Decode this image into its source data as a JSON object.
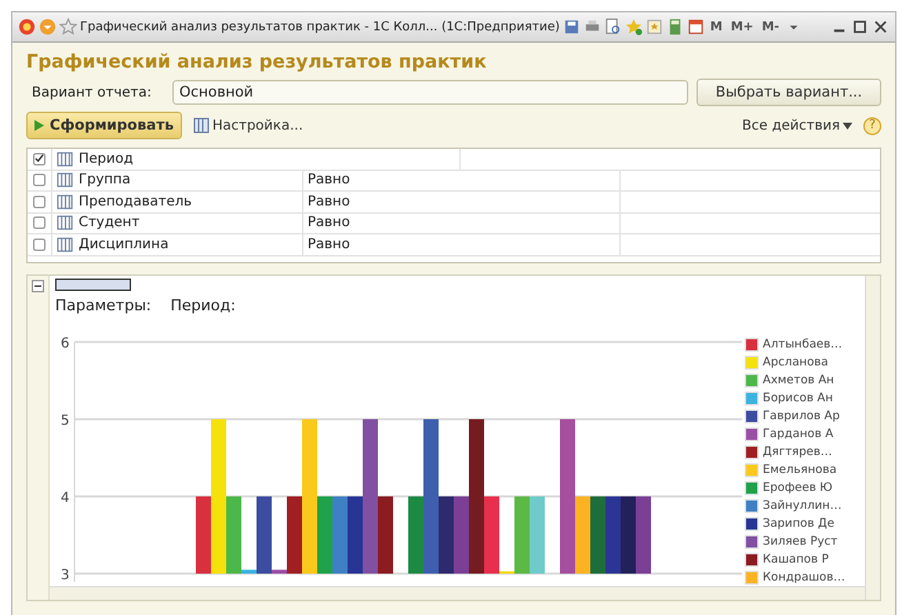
{
  "window": {
    "title": "Графический анализ результатов практик - 1С Колл...  (1С:Предприятие)",
    "memory_buttons": [
      "M",
      "M+",
      "M-"
    ]
  },
  "form": {
    "title": "Графический анализ результатов практик",
    "variant_label": "Вариант отчета:",
    "variant_value": "Основной",
    "choose_button": "Выбрать вариант...",
    "generate_button": "Сформировать",
    "settings_button": "Настройка...",
    "all_actions": "Все действия",
    "help": "?"
  },
  "filters": [
    {
      "name": "Период",
      "checked": true
    },
    {
      "name": "Группа",
      "checked": false,
      "condition": "Равно"
    },
    {
      "name": "Преподаватель",
      "checked": false,
      "condition": "Равно"
    },
    {
      "name": "Студент",
      "checked": false,
      "condition": "Равно"
    },
    {
      "name": "Дисциплина",
      "checked": false,
      "condition": "Равно"
    }
  ],
  "report": {
    "params_label": "Параметры:",
    "period_label": "Период:",
    "chart_data": {
      "type": "bar",
      "ylim": [
        3,
        6
      ],
      "yticks": [
        3,
        4,
        5,
        6
      ],
      "categories": [
        null,
        null,
        null,
        null,
        null,
        null,
        null,
        null,
        null,
        null,
        null,
        null,
        null,
        null,
        null,
        null,
        null,
        null,
        null,
        null,
        null,
        null,
        null,
        null,
        null,
        null,
        null,
        null,
        null,
        null,
        null,
        null,
        null,
        null,
        null,
        null,
        null,
        null,
        null,
        null,
        null,
        null,
        null,
        null
      ],
      "values": [
        null,
        null,
        null,
        null,
        null,
        null,
        null,
        null,
        4,
        5,
        4,
        3.05,
        4,
        3.05,
        4,
        5,
        4,
        4,
        4,
        5,
        4,
        null,
        4,
        5,
        4,
        4,
        5,
        4,
        3.03,
        4,
        4,
        null,
        5,
        4,
        4,
        4,
        4,
        4,
        null,
        null,
        null,
        null,
        null,
        null
      ],
      "colors": [
        null,
        null,
        null,
        null,
        null,
        null,
        null,
        null,
        "#d9303f",
        "#f5e10c",
        "#4cb84a",
        "#3bb3e0",
        "#3c4ca0",
        "#9b4ea6",
        "#a01f22",
        "#fbc91c",
        "#1fa24a",
        "#3f80c4",
        "#283594",
        "#8150a2",
        "#8b1c22",
        null,
        "#1d8a44",
        "#3e5fae",
        "#2e2a6e",
        "#7b3f96",
        "#751c20",
        "#e8304e",
        "#f1d90c",
        "#5cb946",
        "#6ecbc9",
        null,
        "#a54f9e",
        "#fbb323",
        "#1e6e3b",
        "#2b3595",
        "#22215a",
        "#7b3f96",
        null,
        null,
        null,
        null,
        null,
        null
      ]
    },
    "legend": [
      {
        "name": "Алтынбаев…",
        "color": "#d9303f"
      },
      {
        "name": "Арсланова",
        "color": "#f5e10c"
      },
      {
        "name": "Ахметов Ан",
        "color": "#4cb84a"
      },
      {
        "name": "Борисов Ан",
        "color": "#3bb3e0"
      },
      {
        "name": "Гаврилов Ар",
        "color": "#3c4ca0"
      },
      {
        "name": "Гарданов А",
        "color": "#9b4ea6"
      },
      {
        "name": "Дягтярев…",
        "color": "#a01f22"
      },
      {
        "name": "Емельянова",
        "color": "#fbc91c"
      },
      {
        "name": "Ерофеев Ю",
        "color": "#1fa24a"
      },
      {
        "name": "Зайнуллин…",
        "color": "#3f80c4"
      },
      {
        "name": "Зарипов Де",
        "color": "#283594"
      },
      {
        "name": "Зиляев Руст",
        "color": "#8150a2"
      },
      {
        "name": "Кашапов Р",
        "color": "#8b1c22"
      },
      {
        "name": "Кондрашов…",
        "color": "#fbb323"
      }
    ]
  }
}
